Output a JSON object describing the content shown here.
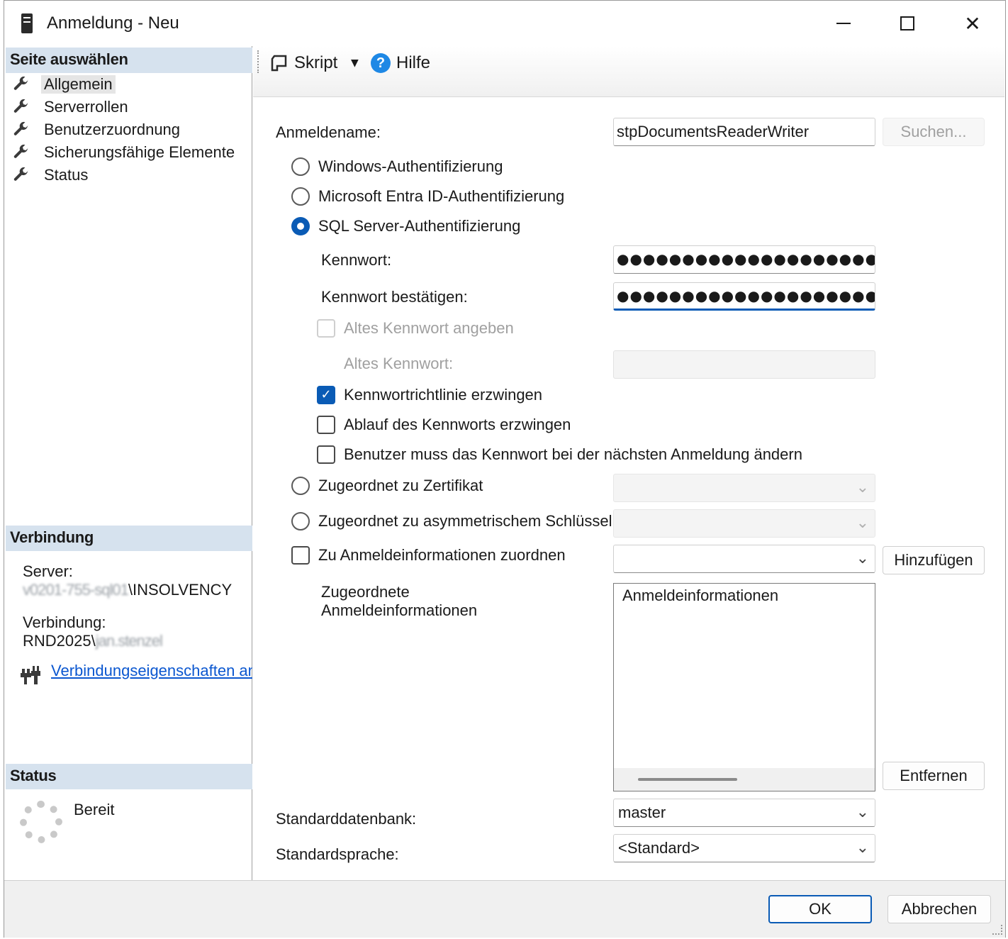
{
  "window": {
    "title": "Anmeldung - Neu"
  },
  "left": {
    "select_page_header": "Seite auswählen",
    "pages": [
      {
        "label": "Allgemein",
        "icon": "wrench-icon",
        "selected": true
      },
      {
        "label": "Serverrollen",
        "icon": "wrench-icon"
      },
      {
        "label": "Benutzerzuordnung",
        "icon": "wrench-icon"
      },
      {
        "label": "Sicherungsfähige Elemente",
        "icon": "wrench-icon"
      },
      {
        "label": "Status",
        "icon": "wrench-icon"
      }
    ],
    "connection_header": "Verbindung",
    "server_label": "Server:",
    "server_value_blurred": "v0201-755-sql01",
    "server_value_suffix": "\\INSOLVENCY",
    "connection_label": "Verbindung:",
    "connection_value_prefix": "RND2025\\",
    "connection_value_blurred": "jan.stenzel",
    "connection_link": "Verbindungseigenschaften anzeigen",
    "status_header": "Status",
    "status_value": "Bereit"
  },
  "toolbar": {
    "script_label": "Skript",
    "help_label": "Hilfe"
  },
  "form": {
    "login_name_label": "Anmeldename:",
    "login_name_value": "stpDocumentsReaderWriter",
    "search_button": "Suchen...",
    "auth_windows": "Windows-Authentifizierung",
    "auth_entra": "Microsoft Entra ID-Authentifizierung",
    "auth_sql": "SQL Server-Authentifizierung",
    "selected_auth": "sql",
    "password_label": "Kennwort:",
    "password_value": "●●●●●●●●●●●●●●●●●●●●●●",
    "confirm_password_label": "Kennwort bestätigen:",
    "confirm_password_value": "●●●●●●●●●●●●●●●●●●●●●●",
    "specify_old_password": "Altes Kennwort angeben",
    "old_password_label": "Altes Kennwort:",
    "enforce_policy": "Kennwortrichtlinie erzwingen",
    "enforce_policy_checked": true,
    "enforce_expiration": "Ablauf des Kennworts erzwingen",
    "must_change": "Benutzer muss das Kennwort bei der nächsten Anmeldung ändern",
    "mapped_certificate": "Zugeordnet zu Zertifikat",
    "mapped_asym_key": "Zugeordnet zu asymmetrischem Schlüssel",
    "map_credential": "Zu Anmeldeinformationen zuordnen",
    "add_button": "Hinzufügen",
    "mapped_credentials_label_1": "Zugeordnete",
    "mapped_credentials_label_2": "Anmeldeinformationen",
    "credentials_column": "Anmeldeinformationen",
    "remove_button": "Entfernen",
    "default_db_label": "Standarddatenbank:",
    "default_db_value": "master",
    "default_lang_label": "Standardsprache:",
    "default_lang_value": "<Standard>"
  },
  "footer": {
    "ok": "OK",
    "cancel": "Abbrechen"
  },
  "colors": {
    "accent": "#0a5bb5",
    "section_header_bg": "#d6e2ee",
    "link": "#0b57d0"
  }
}
